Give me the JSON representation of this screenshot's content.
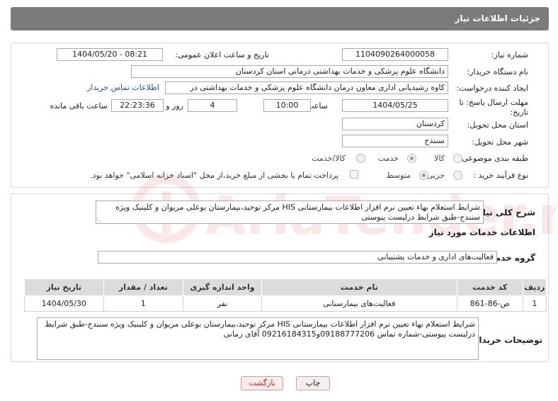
{
  "header": {
    "title": "جزئیات اطلاعات نیاز"
  },
  "form": {
    "need_number_label": "شماره نیاز:",
    "need_number": "1104090264000058",
    "announce_label": "تاریخ و ساعت اعلان عمومی:",
    "announce_value": "1404/05/20 - 08:21",
    "buyer_org_label": "نام دستگاه خریدار:",
    "buyer_org": "دانشگاه علوم پزشکی و خدمات بهداشتی  درمانی استان کردستان",
    "creator_label": "ایجاد کننده درخواست:",
    "creator": "کاوه رشیدپانی اداری معاون درمان دانشگاه علوم پزشکی و خدمات بهداشتی  در",
    "contact_link": "اطلاعات تماس خریدار",
    "deadline_label_1": "مهلت ارسال پاسخ: تا",
    "deadline_label_2": "تاریخ:",
    "deadline_date": "1404/05/25",
    "time_label": "ساعت",
    "deadline_time": "10:00",
    "days_value": "4",
    "days_label": "روز و",
    "remaining_time": "22:23:36",
    "remaining_label": "ساعت باقی مانده",
    "province_label": "استان محل تحویل:",
    "province": "کردستان",
    "city_label": "شهر محل تحویل:",
    "city": "سنندج",
    "category_label": "طبقه بندی موضوعی:",
    "category_options": [
      "کالا",
      "خدمت",
      "کالا/خدمت"
    ],
    "category_selected": "خدمت",
    "process_label": "نوع فرآیند خرید :",
    "process_options": [
      "جزیی",
      "متوسط"
    ],
    "process_selected": "متوسط",
    "payment_note": "پرداخت تمام یا بخشی از مبلغ خرید،از محل \"اسناد خزانه اسلامی\" خواهد بود."
  },
  "details": {
    "summary_label": "شرح کلی نیاز:",
    "summary": "شرایط استعلام بهاء تعیین نرم افزار اطلاعات بیمارستانی HIS مرکز توحید،بیمارستان بوعلی مریوان و کلینیک ویژه سنندج-طبق شرایط درلیست پیوستی",
    "services_heading": "اطلاعات خدمات مورد نیاز",
    "service_group_label": "گروه خدمت:",
    "service_group": "فعالیت‌های اداری و خدمات پشتیبانی",
    "table": {
      "headers": [
        "ردیف",
        "کد خدمت",
        "نام خدمت",
        "واحد اندازه گیری",
        "تعداد / مقدار",
        "تاریخ نیاز"
      ],
      "rows": [
        [
          "1",
          "ص-86-861",
          "فعالیت‌های بیمارستانی",
          "نفر",
          "1",
          "1404/05/30"
        ]
      ]
    },
    "buyer_notes_label": "توضیحات خریدار:",
    "buyer_notes": "شرایط استعلام بهاء تعیین نرم افزار اطلاعات بیمارستانی HIS مرکز توحید،بیمارستان بوعلی مریوان و کلینیک ویژه سنندج-طبق شرایط درلیست پیوستی-شماره تماس 09188777206و09216184315 آقای زمانی"
  },
  "buttons": {
    "print": "چاپ",
    "back": "بازگشت"
  },
  "watermark_text": "AriaTender.net"
}
